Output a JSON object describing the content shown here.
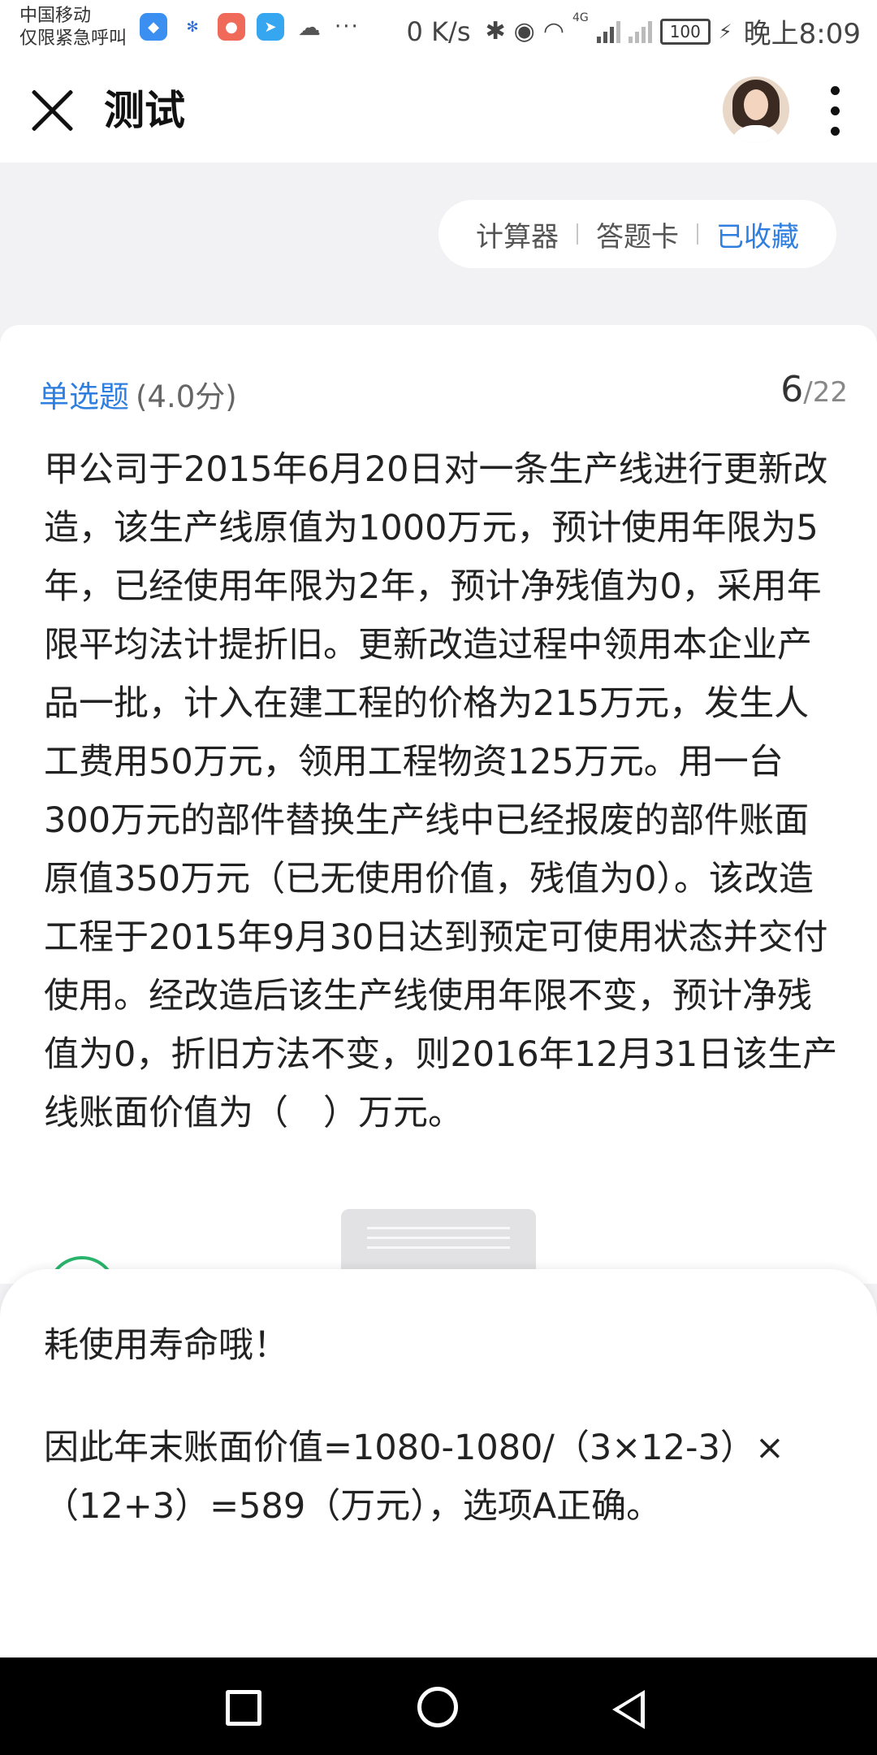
{
  "status_bar": {
    "carrier_line1": "中国移动",
    "carrier_line2": "仅限紧急呼叫",
    "more": "···",
    "net_speed": "0 K/s",
    "network_type": "4G",
    "battery": "100",
    "time": "晚上8:09"
  },
  "header": {
    "title": "测试"
  },
  "tools": {
    "calculator": "计算器",
    "answer_card": "答题卡",
    "favorited": "已收藏"
  },
  "question": {
    "type": "单选题",
    "score": "(4.0分)",
    "current": "6",
    "total": "/22",
    "text": "甲公司于2015年6月20日对一条生产线进行更新改造，该生产线原值为1000万元，预计使用年限为5年，已经使用年限为2年，预计净残值为0，采用年限平均法计提折旧。更新改造过程中领用本企业产品一批，计入在建工程的价格为215万元，发生人工费用50万元，领用工程物资125万元。用一台300万元的部件替换生产线中已经报废的部件账面原值350万元（已无使用价值，残值为0）。该改造工程于2015年9月30日达到预定可使用状态并交付使用。经改造后该生产线使用年限不变，预计净残值为0，折旧方法不变，则2016年12月31日该生产线账面价值为（　）万元。"
  },
  "analysis": {
    "line1": "耗使用寿命哦！",
    "line2": "因此年末账面价值=1080-1080/（3×12-3）×（12+3）=589（万元），选项A正确。"
  },
  "colors": {
    "accent": "#2f7fe0",
    "option_ring": "#29b36b"
  }
}
